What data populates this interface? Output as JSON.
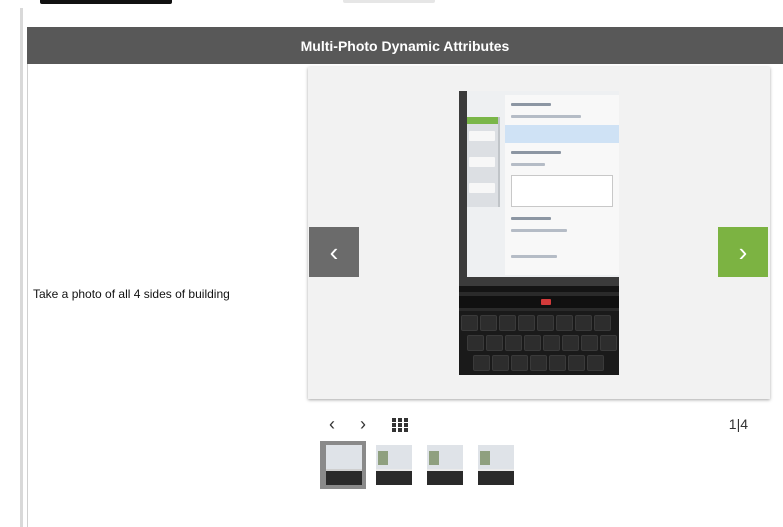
{
  "section": {
    "title": "Multi-Photo Dynamic Attributes"
  },
  "attribute": {
    "prompt": "Take a photo of all 4 sides of building"
  },
  "viewer": {
    "prev_icon": "chevron-left-icon",
    "next_icon": "chevron-right-icon",
    "prev_glyph": "‹",
    "next_glyph": "›",
    "accent_color": "#7cb342",
    "prev_bg_color": "#6b6b6b"
  },
  "controls": {
    "prev_glyph": "‹",
    "next_glyph": "›",
    "grid_icon": "grid-icon",
    "counter": "1|4"
  },
  "thumbnails": [
    {
      "selected": true
    },
    {
      "selected": false
    },
    {
      "selected": false
    },
    {
      "selected": false
    }
  ]
}
